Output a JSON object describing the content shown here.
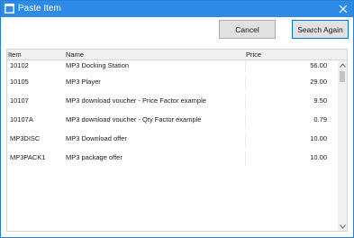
{
  "window": {
    "title": "Paste Item",
    "title_icon": "window-icon",
    "accent_color": "#2b8be6"
  },
  "toolbar": {
    "cancel_label": "Cancel",
    "search_again_label": "Search Again"
  },
  "grid": {
    "columns": [
      "Item",
      "Name",
      "Price"
    ],
    "rows": [
      {
        "item": "10102",
        "name": "MP3 Docking Station",
        "price": "56.00"
      },
      {
        "item": "10105",
        "name": "MP3 Player",
        "price": "29.00"
      },
      {
        "item": "10107",
        "name": "MP3 download voucher - Price Factor example",
        "price": "9.50"
      },
      {
        "item": "10107A",
        "name": "MP3 download voucher - Qty Factor example",
        "price": "0.79"
      },
      {
        "item": "MP3DISC",
        "name": "MP3 Download offer",
        "price": "10.00"
      },
      {
        "item": "MP3PACK1",
        "name": "MP3 package offer",
        "price": "10.00"
      }
    ]
  }
}
